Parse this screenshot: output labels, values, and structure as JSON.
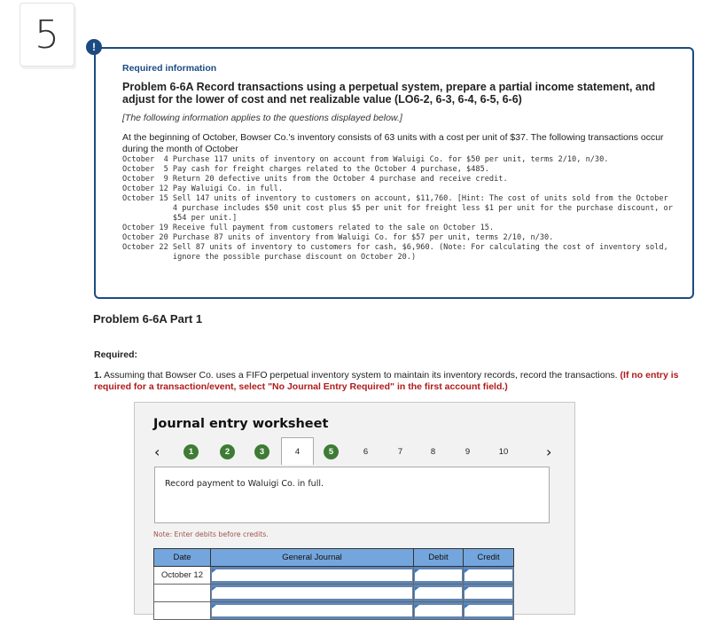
{
  "question_number": "5",
  "info": {
    "alert_icon": "!",
    "heading": "Required information",
    "title": "Problem 6-6A Record transactions using a perpetual system, prepare a partial income statement, and adjust for the lower of cost and net realizable value (LO6-2, 6-3, 6-4, 6-5, 6-6)",
    "applies_note": "[The following information applies to the questions displayed below.]",
    "intro": "At the beginning of October, Bowser Co.'s inventory consists of 63 units with a cost per unit of $37. The following transactions occur during the month of October",
    "transactions": [
      {
        "date": "October  4 ",
        "text": "Purchase 117 units of inventory on account from Waluigi Co. for $50 per unit, terms 2/10, n/30."
      },
      {
        "date": "October  5 ",
        "text": "Pay cash for freight charges related to the October 4 purchase, $485."
      },
      {
        "date": "October  9 ",
        "text": "Return 20 defective units from the October 4 purchase and receive credit."
      },
      {
        "date": "October 12 ",
        "text": "Pay Waluigi Co. in full."
      },
      {
        "date": "October 15 ",
        "text": "Sell 147 units of inventory to customers on account, $11,760. [Hint: The cost of units sold from the October 4 purchase includes $50 unit cost plus $5 per unit for freight less $1 per unit for the purchase discount, or $54 per unit.]"
      },
      {
        "date": "October 19 ",
        "text": "Receive full payment from customers related to the sale on October 15."
      },
      {
        "date": "October 20 ",
        "text": "Purchase 87 units of inventory from Waluigi Co. for $57 per unit, terms 2/10, n/30."
      },
      {
        "date": "October 22 ",
        "text": "Sell 87 units of inventory to customers for cash, $6,960. (Note: For calculating the cost of inventory sold, ignore the possible purchase discount on October 20.)"
      }
    ]
  },
  "part_title": "Problem 6-6A Part 1",
  "required_label": "Required:",
  "instruction": {
    "number": "1.",
    "text": " Assuming that Bowser Co. uses a FIFO perpetual inventory system to maintain its inventory records, record the transactions. ",
    "red_text": "(If no entry is required for a transaction/event, select \"No Journal Entry Required\" in the first account field.)"
  },
  "worksheet": {
    "title": "Journal entry worksheet",
    "prev_icon": "‹",
    "next_icon": "›",
    "steps": [
      {
        "label": "1",
        "state": "done"
      },
      {
        "label": "2",
        "state": "done"
      },
      {
        "label": "3",
        "state": "done"
      },
      {
        "label": "4",
        "state": "active"
      },
      {
        "label": "5",
        "state": "done"
      },
      {
        "label": "6",
        "state": "plain"
      },
      {
        "label": "7",
        "state": "plain"
      },
      {
        "label": "8",
        "state": "plain"
      },
      {
        "label": "9",
        "state": "plain"
      },
      {
        "label": "10",
        "state": "plain"
      }
    ],
    "description": "Record payment to Waluigi Co. in full.",
    "note": "Note: Enter debits before credits.",
    "table": {
      "headers": [
        "Date",
        "General Journal",
        "Debit",
        "Credit"
      ],
      "rows": [
        {
          "date": "October 12",
          "account": "",
          "debit": "",
          "credit": ""
        },
        {
          "date": "",
          "account": "",
          "debit": "",
          "credit": ""
        },
        {
          "date": "",
          "account": "",
          "debit": "",
          "credit": ""
        }
      ]
    }
  },
  "colors": {
    "accent_navy": "#1c4b82",
    "step_done_green": "#3e7b35",
    "table_header_blue": "#74a6dd",
    "warning_red": "#b01a1a"
  }
}
